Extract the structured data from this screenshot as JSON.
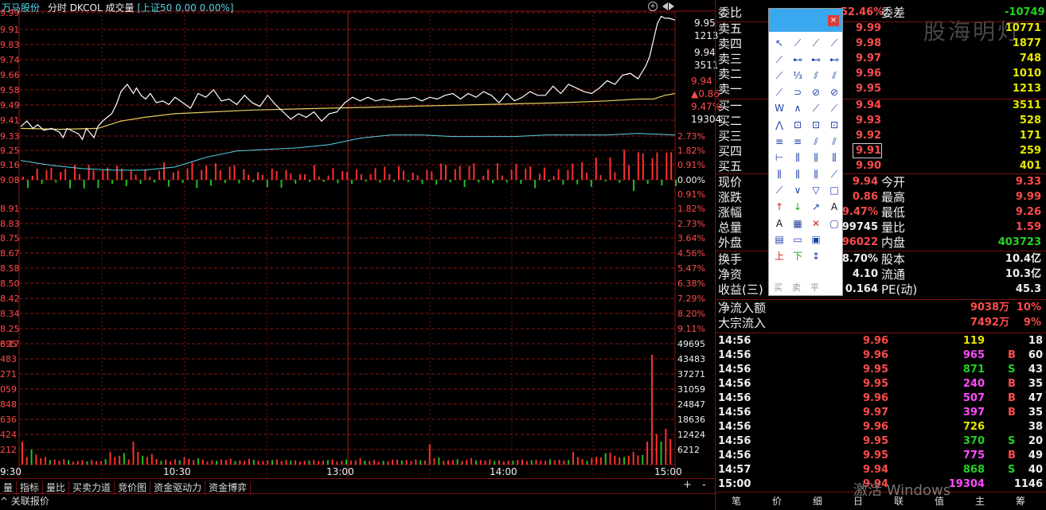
{
  "header": {
    "stock_name": "万马股份",
    "mode": "分时",
    "indicator": "DKCOL",
    "volume_label": "成交量",
    "index_info": "[上证50 0.00 0.00%]"
  },
  "chart_data": {
    "type": "line",
    "title": "",
    "x_ticks": [
      "9:30",
      "10:30",
      "13:00",
      "14:00",
      "15:00"
    ],
    "price_axis_left": [
      "9.99",
      "9.91",
      "9.83",
      "9.74",
      "9.66",
      "9.58",
      "9.49",
      "9.41",
      "9.33",
      "9.25",
      "9.16",
      "9.08",
      "8.91",
      "8.83",
      "8.75",
      "8.67",
      "8.58",
      "8.50",
      "8.42",
      "8.34",
      "8.25",
      "8.17"
    ],
    "pct_axis_right": [
      "0.00%",
      "0.91%",
      "1.82%",
      "2.73%",
      "3.64%",
      "4.56%",
      "5.47%",
      "6.38%",
      "7.29%",
      "8.20%",
      "9.11%"
    ],
    "vol_axis_left": [
      "695",
      "483",
      "271",
      "059",
      "848",
      "636",
      "424",
      "212"
    ],
    "vol_axis_right": [
      "49695",
      "43483",
      "37271",
      "31059",
      "24847",
      "18636",
      "12424",
      "6212"
    ],
    "price_series": {
      "name": "",
      "x": [
        0,
        8,
        16,
        22,
        30,
        40,
        50,
        55,
        60,
        70,
        75,
        80,
        85,
        95,
        100,
        106,
        112,
        118,
        124,
        130,
        138,
        146,
        150,
        156,
        162,
        168,
        176,
        184,
        192,
        200,
        210,
        220,
        230,
        240,
        250,
        260,
        270,
        280,
        290,
        300,
        310,
        320,
        330,
        340,
        350,
        360,
        370,
        380,
        390,
        400,
        410,
        420,
        430,
        440,
        450,
        460,
        470,
        480,
        490,
        500,
        510,
        520,
        530,
        540,
        550,
        560,
        570,
        580,
        590,
        600,
        610,
        620,
        630,
        640,
        650,
        660,
        670,
        680,
        690,
        700,
        710,
        720,
        730,
        740,
        750,
        760,
        770,
        780,
        790,
        800,
        810,
        815,
        820,
        825,
        830,
        835,
        840,
        848
      ],
      "y": [
        9.37,
        9.4,
        9.36,
        9.38,
        9.35,
        9.36,
        9.34,
        9.31,
        9.36,
        9.34,
        9.33,
        9.3,
        9.36,
        9.31,
        9.37,
        9.4,
        9.42,
        9.44,
        9.49,
        9.56,
        9.6,
        9.55,
        9.58,
        9.54,
        9.52,
        9.55,
        9.5,
        9.51,
        9.49,
        9.53,
        9.5,
        9.47,
        9.55,
        9.53,
        9.57,
        9.51,
        9.52,
        9.49,
        9.54,
        9.5,
        9.48,
        9.54,
        9.49,
        9.45,
        9.41,
        9.44,
        9.42,
        9.45,
        9.4,
        9.44,
        9.45,
        9.5,
        9.53,
        9.51,
        9.53,
        9.51,
        9.52,
        9.51,
        9.52,
        9.52,
        9.53,
        9.51,
        9.53,
        9.52,
        9.54,
        9.55,
        9.52,
        9.55,
        9.53,
        9.56,
        9.54,
        9.5,
        9.55,
        9.51,
        9.53,
        9.56,
        9.54,
        9.54,
        9.59,
        9.55,
        9.6,
        9.58,
        9.56,
        9.55,
        9.58,
        9.62,
        9.6,
        9.65,
        9.66,
        9.63,
        9.7,
        9.75,
        9.84,
        9.93,
        9.97,
        9.96,
        9.96,
        9.95
      ]
    },
    "avg_series": {
      "name": "",
      "x": [
        0,
        50,
        100,
        130,
        160,
        200,
        300,
        400,
        500,
        600,
        700,
        760,
        800,
        820,
        835,
        848
      ],
      "y": [
        9.36,
        9.355,
        9.36,
        9.4,
        9.42,
        9.44,
        9.46,
        9.47,
        9.48,
        9.49,
        9.5,
        9.51,
        9.52,
        9.52,
        9.54,
        9.55
      ]
    },
    "dkcol_series": {
      "name": "",
      "x": [
        0,
        40,
        80,
        120,
        160,
        200,
        240,
        280,
        320,
        360,
        400,
        440,
        480,
        520,
        560,
        600,
        640,
        680,
        720,
        760,
        800,
        848
      ],
      "y": [
        1.2,
        0.9,
        0.7,
        0.6,
        0.6,
        0.8,
        1.4,
        1.8,
        1.9,
        2.0,
        2.2,
        2.6,
        2.8,
        2.8,
        2.7,
        2.7,
        2.7,
        2.8,
        2.8,
        2.8,
        2.9,
        2.8
      ]
    },
    "volume_bars_x": [
      2,
      8,
      14,
      20,
      26,
      32,
      38,
      44,
      50,
      56,
      62,
      68,
      74,
      80,
      86,
      92,
      98,
      104,
      110,
      116,
      122,
      128,
      134,
      140,
      146,
      152,
      158,
      164,
      170,
      176,
      182,
      188,
      194,
      200,
      206,
      212,
      218,
      224,
      230,
      236,
      242,
      248,
      254,
      260,
      266,
      272,
      278,
      284,
      290,
      296,
      302,
      308,
      314,
      320,
      326,
      332,
      338,
      344,
      350,
      356,
      362,
      368,
      374,
      380,
      386,
      392,
      398,
      404,
      410,
      416,
      422,
      428,
      434,
      440,
      446,
      452,
      458,
      464,
      470,
      476,
      482,
      488,
      494,
      500,
      506,
      512,
      518,
      524,
      530,
      536,
      542,
      548,
      554,
      560,
      566,
      572,
      578,
      584,
      590,
      596,
      602,
      608,
      614,
      620,
      626,
      632,
      638,
      644,
      650,
      656,
      662,
      668,
      674,
      680,
      686,
      692,
      698,
      704,
      710,
      716,
      722,
      728,
      734,
      740,
      746,
      752,
      758,
      764,
      770,
      776,
      782,
      788,
      794,
      800,
      806,
      812,
      818,
      824,
      830,
      836,
      842
    ],
    "volume_bars_v": [
      9000,
      3000,
      6000,
      4000,
      2500,
      3000,
      1800,
      2000,
      1500,
      2200,
      1800,
      1200,
      1500,
      1800,
      1300,
      1800,
      1300,
      1400,
      2200,
      5000,
      3000,
      3500,
      4500,
      2000,
      9000,
      5000,
      3500,
      3000,
      4200,
      2200,
      1500,
      2000,
      1300,
      2100,
      1700,
      3000,
      2300,
      1800,
      2500,
      2000,
      1200,
      1700,
      1500,
      2000,
      1800,
      2300,
      1400,
      1700,
      1500,
      2300,
      1900,
      1500,
      1400,
      1700,
      1800,
      2000,
      1400,
      1800,
      1600,
      1700,
      1200,
      1500,
      1600,
      1800,
      1400,
      1500,
      1800,
      2000,
      1300,
      1500,
      2000,
      1600,
      1700,
      2500,
      1600,
      1400,
      1800,
      1200,
      1500,
      1300,
      2000,
      1900,
      1600,
      1800,
      1400,
      2000,
      1700,
      1600,
      8000,
      2500,
      2800,
      1500,
      1700,
      1800,
      2100,
      1400,
      1900,
      2600,
      1700,
      1800,
      1600,
      2000,
      1500,
      1700,
      1300,
      1600,
      1500,
      1800,
      2000,
      1400,
      1700,
      1900,
      1600,
      1600,
      2100,
      1700,
      1900,
      1600,
      1800,
      5000,
      3000,
      2200,
      1600,
      2600,
      3000,
      2800,
      4500,
      4800,
      3500,
      2800,
      3000,
      3500,
      5000,
      3600,
      3800,
      9000,
      43000,
      12000,
      9000,
      14000,
      10000,
      5000
    ]
  },
  "side_labels": {
    "wei_bi": "委比",
    "wei_bi_val": "52.46%",
    "wei_cha": "委差",
    "wei_cha_val": "-10749",
    "watermark": "股海明灯"
  },
  "asks": [
    {
      "label": "卖五",
      "price": "9.99",
      "vol": "10771"
    },
    {
      "label": "卖四",
      "price": "9.98",
      "vol": "1877"
    },
    {
      "label": "卖三",
      "price": "9.97",
      "vol": "748"
    },
    {
      "label": "卖二",
      "price": "9.96",
      "vol": "1010"
    },
    {
      "label": "卖一",
      "price": "9.95",
      "vol": "1213"
    }
  ],
  "bids": [
    {
      "label": "买一",
      "price": "9.94",
      "vol": "3511"
    },
    {
      "label": "买二",
      "price": "9.93",
      "vol": "528"
    },
    {
      "label": "买三",
      "price": "9.92",
      "vol": "171"
    },
    {
      "label": "买四",
      "price": "9.91",
      "vol": "259"
    },
    {
      "label": "买五",
      "price": "9.90",
      "vol": "401"
    }
  ],
  "stats": [
    {
      "l1": "现价",
      "v1": "9.94",
      "l2": "今开",
      "v2": "9.33"
    },
    {
      "l1": "涨跌",
      "v1": "0.86",
      "l2": "最高",
      "v2": "9.99"
    },
    {
      "l1": "涨幅",
      "v1": "9.47%",
      "l2": "最低",
      "v2": "9.26"
    },
    {
      "l1": "总量",
      "v1": "899745",
      "l2": "量比",
      "v2": "1.59"
    },
    {
      "l1": "外盘",
      "v1": "496022",
      "l2": "内盘",
      "v2": "403723"
    }
  ],
  "stats2": [
    {
      "l1": "换手",
      "v1": "8.70%",
      "l2": "股本",
      "v2": "10.4亿"
    },
    {
      "l1": "净资",
      "v1": "4.10",
      "l2": "流通",
      "v2": "10.3亿"
    },
    {
      "l1": "收益(三)",
      "v1": "0.164",
      "l2": "PE(动)",
      "v2": "45.3"
    }
  ],
  "flows": [
    {
      "label": "净流入额",
      "val": "9038万",
      "pct": "10%"
    },
    {
      "label": "大宗流入",
      "val": "7492万",
      "pct": "9%"
    }
  ],
  "trades": [
    {
      "t": "14:56",
      "p": "9.96",
      "v": "119",
      "f": "",
      "n": "18"
    },
    {
      "t": "14:56",
      "p": "9.96",
      "v": "965",
      "f": "B",
      "n": "60"
    },
    {
      "t": "14:56",
      "p": "9.95",
      "v": "871",
      "f": "S",
      "n": "43"
    },
    {
      "t": "14:56",
      "p": "9.95",
      "v": "240",
      "f": "B",
      "n": "35"
    },
    {
      "t": "14:56",
      "p": "9.96",
      "v": "507",
      "f": "B",
      "n": "47"
    },
    {
      "t": "14:56",
      "p": "9.97",
      "v": "397",
      "f": "B",
      "n": "35"
    },
    {
      "t": "14:56",
      "p": "9.96",
      "v": "726",
      "f": "",
      "n": "38"
    },
    {
      "t": "14:56",
      "p": "9.95",
      "v": "370",
      "f": "S",
      "n": "20"
    },
    {
      "t": "14:56",
      "p": "9.95",
      "v": "775",
      "f": "B",
      "n": "49"
    },
    {
      "t": "14:57",
      "p": "9.94",
      "v": "868",
      "f": "S",
      "n": "40"
    },
    {
      "t": "15:00",
      "p": "9.94",
      "v": "19304",
      "f": "",
      "n": "1146"
    }
  ],
  "price_tags": {
    "ask1": "9.95",
    "ask1_vol": "1213",
    "bid1": "9.94",
    "bid1_vol": "3511",
    "last": "9.94",
    "chg": "▲0.86",
    "pct": "9.47%",
    "vol": "19304"
  },
  "bottom_tabs": [
    "量",
    "指标",
    "量比",
    "买卖力道",
    "竞价图",
    "资金驱动力",
    "资金博弈"
  ],
  "bottom_tab2": "关联报价",
  "side_bottom_tabs": [
    "笔",
    "价",
    "细",
    "日",
    "联",
    "值",
    "主",
    "筹"
  ],
  "windows_watermark": "激活 Windows",
  "pct_header": "",
  "toolbar": {
    "plus": "+",
    "minus": "-",
    "close": "×"
  }
}
